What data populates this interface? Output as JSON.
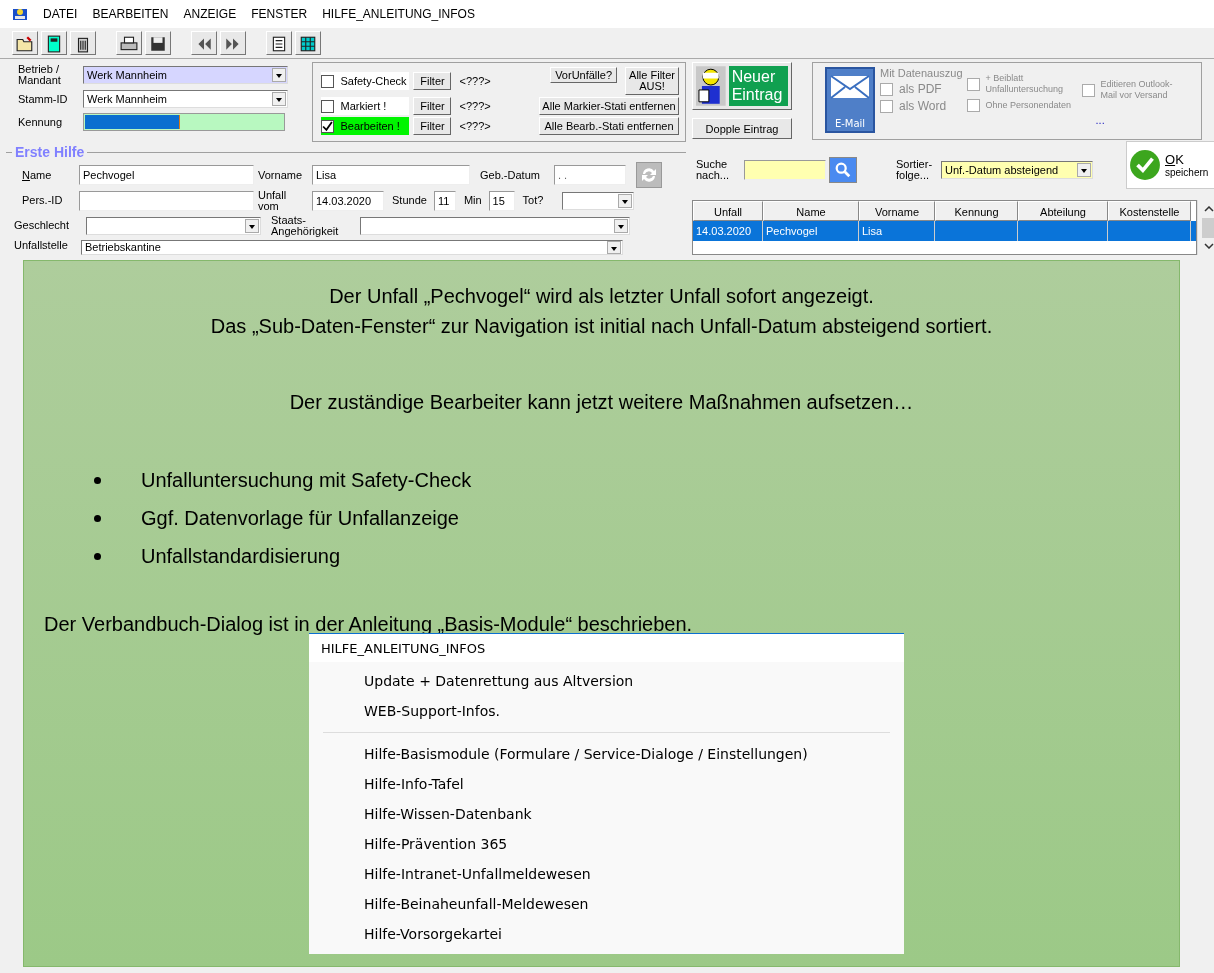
{
  "menu": [
    "DATEI",
    "BEARBEITEN",
    "ANZEIGE",
    "FENSTER",
    "HILFE_ANLEITUNG_INFOS"
  ],
  "master": {
    "betrieb_label": "Betrieb / Mandant",
    "betrieb": "Werk Mannheim",
    "stamm_label": "Stamm-ID",
    "stamm": "Werk Mannheim",
    "kennung_label": "Kennung",
    "kennung": {
      "level": 0.48
    }
  },
  "filters": [
    {
      "label": "Safety-Check",
      "checked": false,
      "button": "Filter",
      "value": "<???>"
    },
    {
      "label": "Markiert !",
      "checked": false,
      "button": "Filter",
      "value": "<???>"
    },
    {
      "label": "Bearbeiten !",
      "checked": true,
      "button": "Filter",
      "value": "<???>"
    }
  ],
  "filter_buttons": {
    "vorunfaelle": "VorUnfälle?",
    "all_off": "Alle Filter AUS!",
    "clear_mark": "Alle Markier-Stati entfernen",
    "clear_edit": "Alle Bearb.-Stati entfernen"
  },
  "entry": {
    "new": "Neuer Eintrag",
    "duplicate": "Dopple Eintrag"
  },
  "email": {
    "button": "E-Mail",
    "group": "Mit Datenauszug",
    "more": "...",
    "options": [
      {
        "label": "als PDF",
        "checked": false,
        "disabled": true
      },
      {
        "label": "als Word",
        "checked": false,
        "disabled": true
      },
      {
        "label": "+ Beiblatt Unfalluntersuchung",
        "checked": false,
        "disabled": true
      },
      {
        "label": "Ohne Personendaten",
        "checked": false,
        "disabled": true
      },
      {
        "label": "Editieren Outlook-Mail vor Versand",
        "checked": false,
        "disabled": true
      }
    ]
  },
  "form": {
    "title": "Erste Hilfe",
    "name_label": "Name",
    "name": "Pechvogel",
    "vorname_label": "Vorname",
    "vorname": "Lisa",
    "geb_label": "Geb.-Datum",
    "geb": " .  .",
    "persid_label": "Pers.-ID",
    "unfall_label": "Unfall vom",
    "unfall": "14.03.2020",
    "stunde_label": "Stunde",
    "stunde": "11",
    "min_label": "Min",
    "min": "15",
    "tot_label": "Tot?",
    "geschlecht_label": "Geschlecht",
    "staat_label": "Staats-Angehörigkeit",
    "stelle_label": "Unfallstelle",
    "stelle": "Betriebskantine"
  },
  "search": {
    "label": "Suche nach...",
    "sort_label": "Sortier-folge...",
    "sort": "Unf.-Datum absteigend",
    "ok": "OK",
    "ok_sub": "speichern"
  },
  "table": {
    "columns": [
      "Unfall",
      "Name",
      "Vorname",
      "Kennung",
      "Abteilung",
      "Kostenstelle"
    ],
    "rows": [
      {
        "cells": [
          "14.03.2020",
          "Pechvogel",
          "Lisa",
          "",
          "",
          ""
        ],
        "selected": true
      }
    ]
  },
  "note": {
    "lines": [
      "Der Unfall „Pechvogel“ wird als letzter Unfall sofort angezeigt.",
      "Das „Sub-Daten-Fenster“ zur Navigation ist initial nach Unfall-Datum absteigend sortiert."
    ],
    "intro": "Der zuständige Bearbeiter kann jetzt weitere Maßnahmen aufsetzen…",
    "bullets": [
      "Unfalluntersuchung mit Safety-Check",
      "Ggf. Datenvorlage für Unfallanzeige",
      "Unfallstandardisierung"
    ],
    "footer": "Der Verbandbuch-Dialog ist in der Anleitung „Basis-Module“ beschrieben."
  },
  "popup": {
    "title": "HILFE_ANLEITUNG_INFOS",
    "items": [
      {
        "kind": "item",
        "label": "Update + Datenrettung aus Altversion"
      },
      {
        "kind": "item",
        "label": "WEB-Support-Infos."
      },
      {
        "kind": "separator"
      },
      {
        "kind": "item",
        "label": "Hilfe-Basismodule (Formulare / Service-Dialoge / Einstellungen)"
      },
      {
        "kind": "item",
        "label": "Hilfe-Info-Tafel"
      },
      {
        "kind": "item",
        "label": "Hilfe-Wissen-Datenbank"
      },
      {
        "kind": "item",
        "label": "Hilfe-Prävention 365"
      },
      {
        "kind": "item",
        "label": "Hilfe-Intranet-Unfallmeldewesen"
      },
      {
        "kind": "item",
        "label": "Hilfe-Beinaheunfall-Meldewesen"
      },
      {
        "kind": "item",
        "label": "Hilfe-Vorsorgekartei"
      }
    ]
  }
}
